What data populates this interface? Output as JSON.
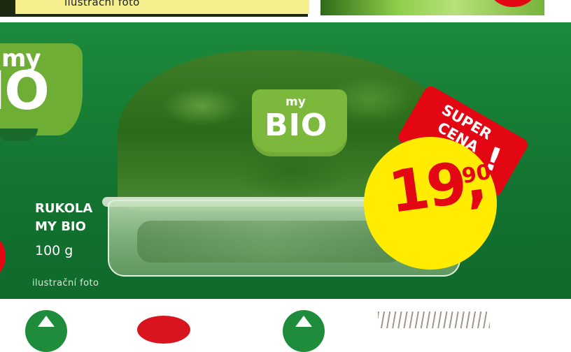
{
  "top_row": {
    "caption": "ilustrační foto"
  },
  "logo_left": {
    "line1": "my",
    "line2": "IO"
  },
  "product": {
    "name_line1": "RUKOLA",
    "name_line2": "MY BIO",
    "weight": "100 g",
    "note": "ilustrační foto"
  },
  "sticker": {
    "line1": "my",
    "line2": "BIO"
  },
  "price": {
    "main": "19,",
    "decimals": "90",
    "badge_line1": "SUPER",
    "badge_line2": "CENA",
    "badge_mark": "!"
  },
  "colors": {
    "panel_green": "#137330",
    "logo_green": "#6fae34",
    "price_yellow": "#ffec00",
    "price_red": "#e30613"
  }
}
